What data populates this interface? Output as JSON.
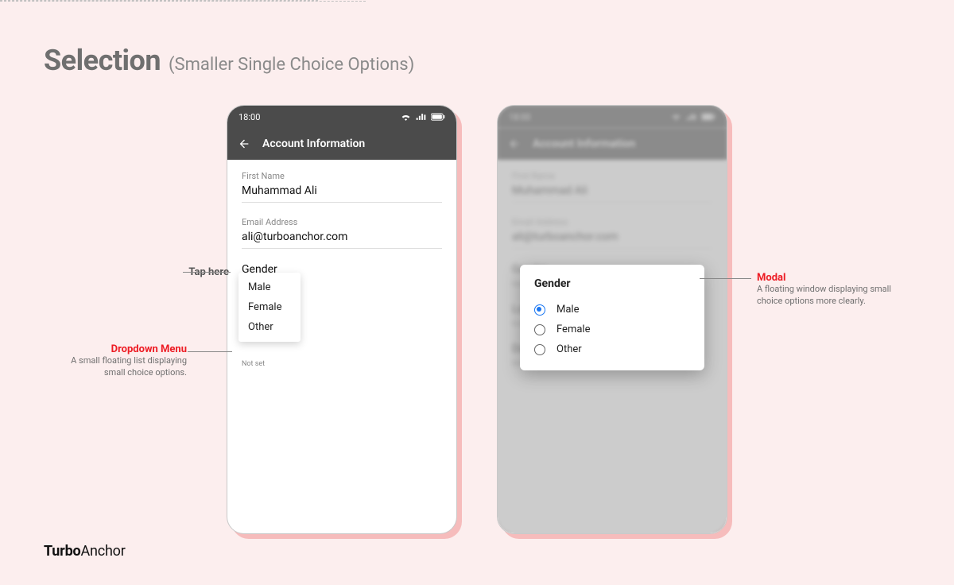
{
  "title": {
    "main": "Selection",
    "sub": "(Smaller Single Choice Options)"
  },
  "brand": {
    "part1": "Turbo",
    "part2": "Anchor"
  },
  "phone": {
    "time": "18:00",
    "appbar_title": "Account Information",
    "fields": {
      "first_name": {
        "label": "First Name",
        "value": "Muhammad Ali"
      },
      "email": {
        "label": "Email Address",
        "value": "ali@turboanchor.com"
      },
      "gender": {
        "label": "Gender",
        "sub": "Not set"
      },
      "location": {
        "label": "Location",
        "sub": "Not set"
      },
      "dob": {
        "label": "Date of Birth",
        "sub": "Not set"
      }
    },
    "dropdown": {
      "items": [
        "Male",
        "Female",
        "Other"
      ]
    },
    "modal": {
      "title": "Gender",
      "options": [
        {
          "label": "Male",
          "checked": true
        },
        {
          "label": "Female",
          "checked": false
        },
        {
          "label": "Other",
          "checked": false
        }
      ]
    }
  },
  "annotations": {
    "tap": {
      "text": "Tap here"
    },
    "dropdown": {
      "title": "Dropdown Menu",
      "desc": "A small floating list displaying small choice options."
    },
    "modal": {
      "title": "Modal",
      "desc": "A floating window displaying small choice options more clearly."
    }
  },
  "colors": {
    "accent": "#ed1c24"
  }
}
